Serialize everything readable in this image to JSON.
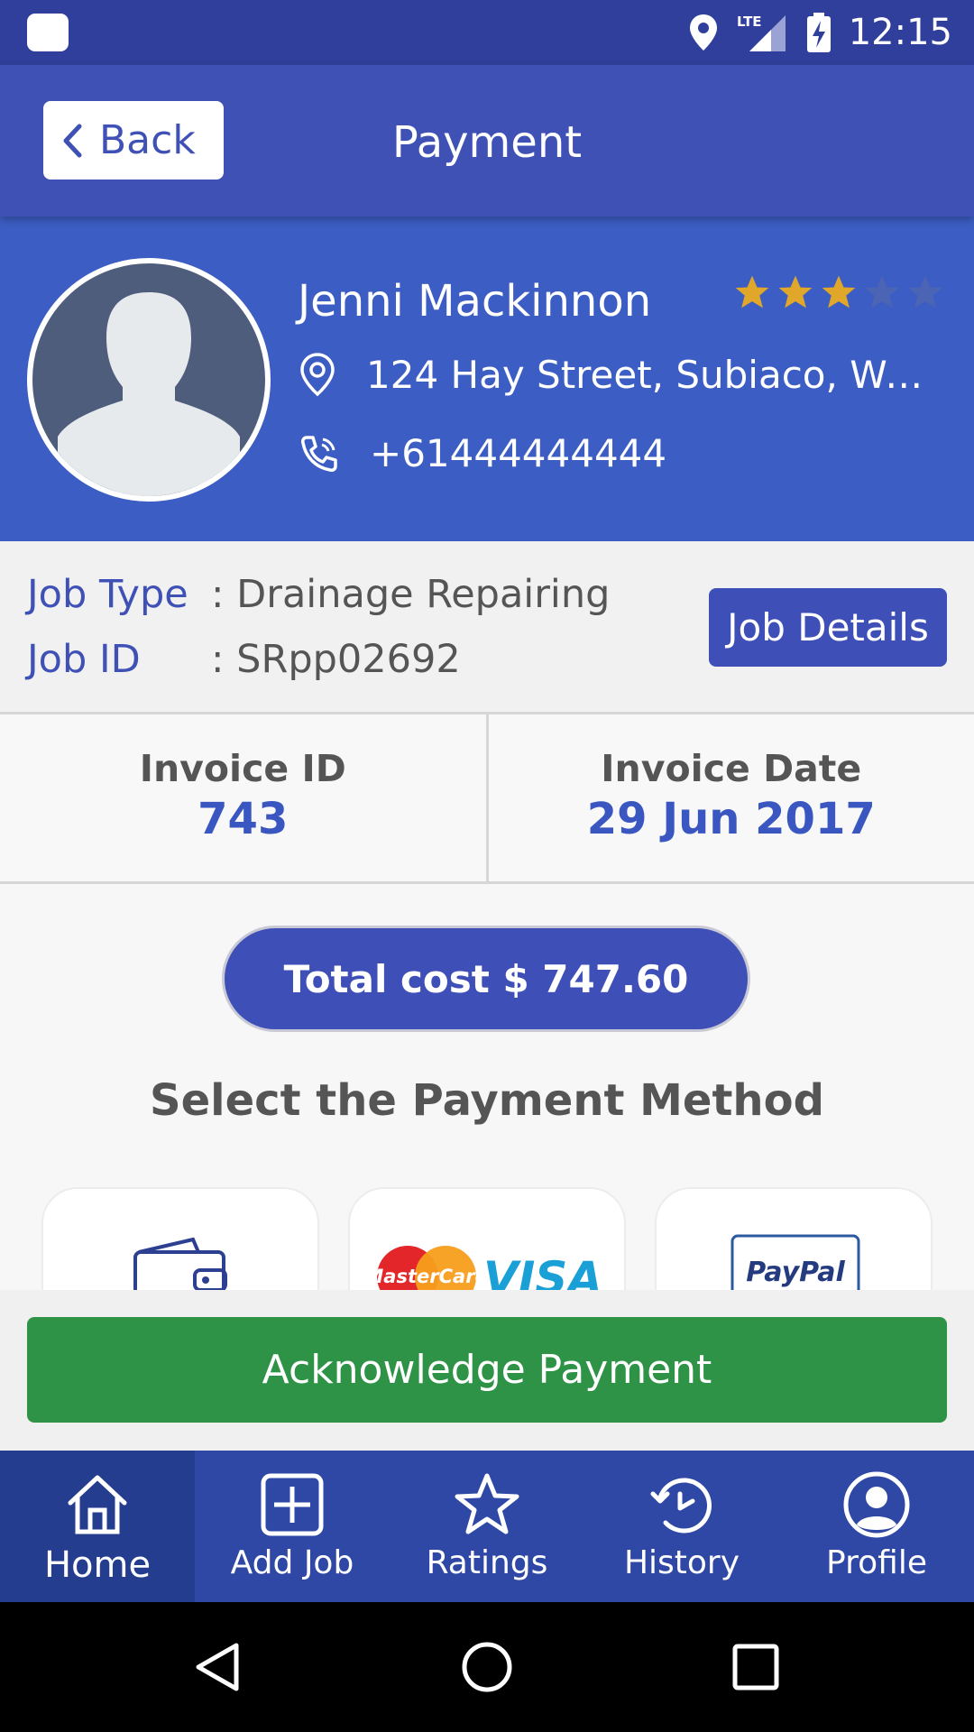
{
  "status_bar": {
    "time": "12:15",
    "network": "LTE"
  },
  "app_bar": {
    "back_label": "Back",
    "title": "Payment"
  },
  "customer": {
    "name": "Jenni Mackinnon",
    "rating": 3,
    "rating_max": 5,
    "address": "124 Hay Street, Subiaco, Wes...",
    "phone": "+61444444444"
  },
  "job": {
    "type_label": "Job Type",
    "type_value": ": Drainage Repairing",
    "id_label": "Job ID",
    "id_value": ": SRpp02692",
    "details_button": "Job Details"
  },
  "invoice": {
    "id_label": "Invoice ID",
    "id_value": "743",
    "date_label": "Invoice Date",
    "date_value": "29 Jun 2017"
  },
  "total_cost": "Total cost $ 747.60",
  "payment_section_title": "Select the Payment Method",
  "payment_methods": [
    {
      "name": "wallet",
      "icon": "wallet-icon"
    },
    {
      "name": "card",
      "mastercard_text": "MasterCard",
      "visa_text": "VISA"
    },
    {
      "name": "paypal",
      "text": "PayPal"
    }
  ],
  "acknowledge_button": "Acknowledge Payment",
  "bottom_nav": [
    {
      "label": "Home",
      "icon": "home-icon",
      "active": true
    },
    {
      "label": "Add Job",
      "icon": "add-box-icon"
    },
    {
      "label": "Ratings",
      "icon": "star-icon"
    },
    {
      "label": "History",
      "icon": "history-icon"
    },
    {
      "label": "Profile",
      "icon": "profile-icon"
    }
  ],
  "colors": {
    "primary": "#3f51b5",
    "header": "#3c5dc3",
    "accent_text": "#3a56c0",
    "success": "#2e9346",
    "star": "#e0a72a"
  }
}
